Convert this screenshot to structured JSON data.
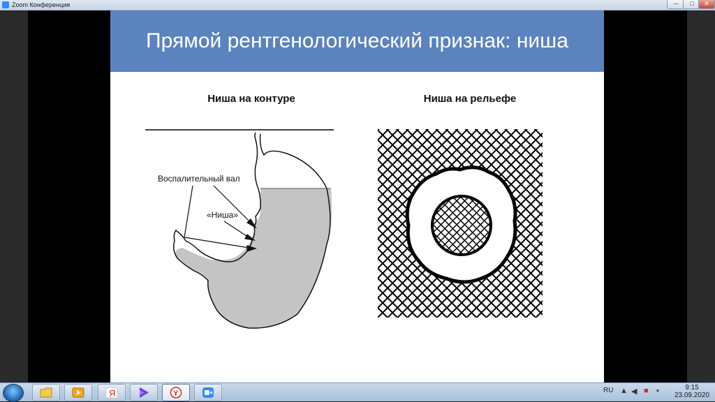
{
  "window": {
    "title": "Zoom Конференция",
    "controls": [
      "─",
      "□",
      "✕"
    ]
  },
  "slide": {
    "title": "Прямой рентгенологический признак: ниша",
    "left_subtitle": "Ниша на контуре",
    "right_subtitle": "Ниша на рельефе",
    "label_inflammatory": "Воспалительный вал",
    "label_niche": "«Ниша»"
  },
  "taskbar": {
    "apps": [
      {
        "name": "explorer",
        "icon": "folder-icon"
      },
      {
        "name": "media-player",
        "icon": "media-player-icon"
      },
      {
        "name": "yandex",
        "icon": "yandex-icon",
        "glyph": "Я"
      },
      {
        "name": "video-app",
        "icon": "play-icon"
      },
      {
        "name": "yandex-browser",
        "icon": "yandex-browser-icon",
        "glyph": "Y"
      },
      {
        "name": "zoom",
        "icon": "zoom-icon"
      }
    ],
    "tray": {
      "language": "RU",
      "time": "9:15",
      "date": "23.09.2020"
    }
  },
  "colors": {
    "slide_header": "#5b83bd",
    "stomach_fill": "#c4c4c4"
  }
}
